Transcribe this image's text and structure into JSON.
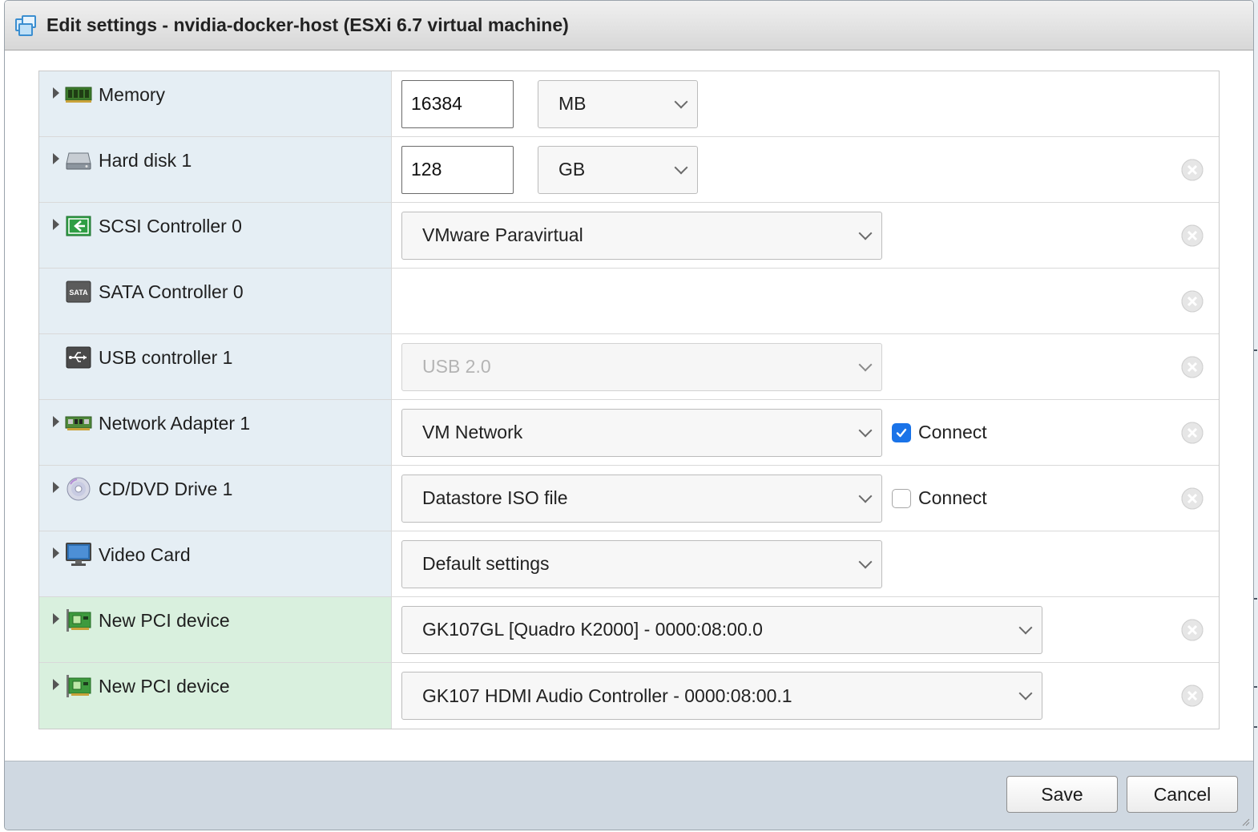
{
  "dialog": {
    "title": "Edit settings - nvidia-docker-host (ESXi 6.7 virtual machine)"
  },
  "devices": [
    {
      "label": "Memory",
      "icon": "memory-icon",
      "expandable": true,
      "value": "16384",
      "unit": "MB",
      "removable": false
    },
    {
      "label": "Hard disk 1",
      "icon": "hard-disk-icon",
      "expandable": true,
      "value": "128",
      "unit": "GB",
      "removable": true
    },
    {
      "label": "SCSI Controller 0",
      "icon": "scsi-controller-icon",
      "expandable": true,
      "select": "VMware Paravirtual",
      "removable": true
    },
    {
      "label": "SATA Controller 0",
      "icon": "sata-controller-icon",
      "expandable": false,
      "removable": true
    },
    {
      "label": "USB controller 1",
      "icon": "usb-controller-icon",
      "expandable": false,
      "select": "USB 2.0",
      "disabled": true,
      "removable": true
    },
    {
      "label": "Network Adapter 1",
      "icon": "network-adapter-icon",
      "expandable": true,
      "select": "VM Network",
      "connect": "Connect",
      "connected": true,
      "removable": true
    },
    {
      "label": "CD/DVD Drive 1",
      "icon": "cd-dvd-icon",
      "expandable": true,
      "select": "Datastore ISO file",
      "connect": "Connect",
      "connected": false,
      "removable": true
    },
    {
      "label": "Video Card",
      "icon": "video-card-icon",
      "expandable": true,
      "select": "Default settings",
      "removable": false
    },
    {
      "label": "New PCI device",
      "icon": "pci-device-icon",
      "expandable": true,
      "select": "GK107GL [Quadro K2000] - 0000:08:00.0",
      "removable": true,
      "isNew": true
    },
    {
      "label": "New PCI device",
      "icon": "pci-device-icon",
      "expandable": true,
      "select": "GK107 HDMI Audio Controller - 0000:08:00.1",
      "removable": true,
      "isNew": true
    }
  ],
  "footer": {
    "save_label": "Save",
    "cancel_label": "Cancel"
  },
  "colors": {
    "label_bg": "#e5eef4",
    "new_label_bg": "#d9f0de",
    "checkbox_checked": "#1a73e8",
    "footer_bg": "#cfd8e1"
  }
}
